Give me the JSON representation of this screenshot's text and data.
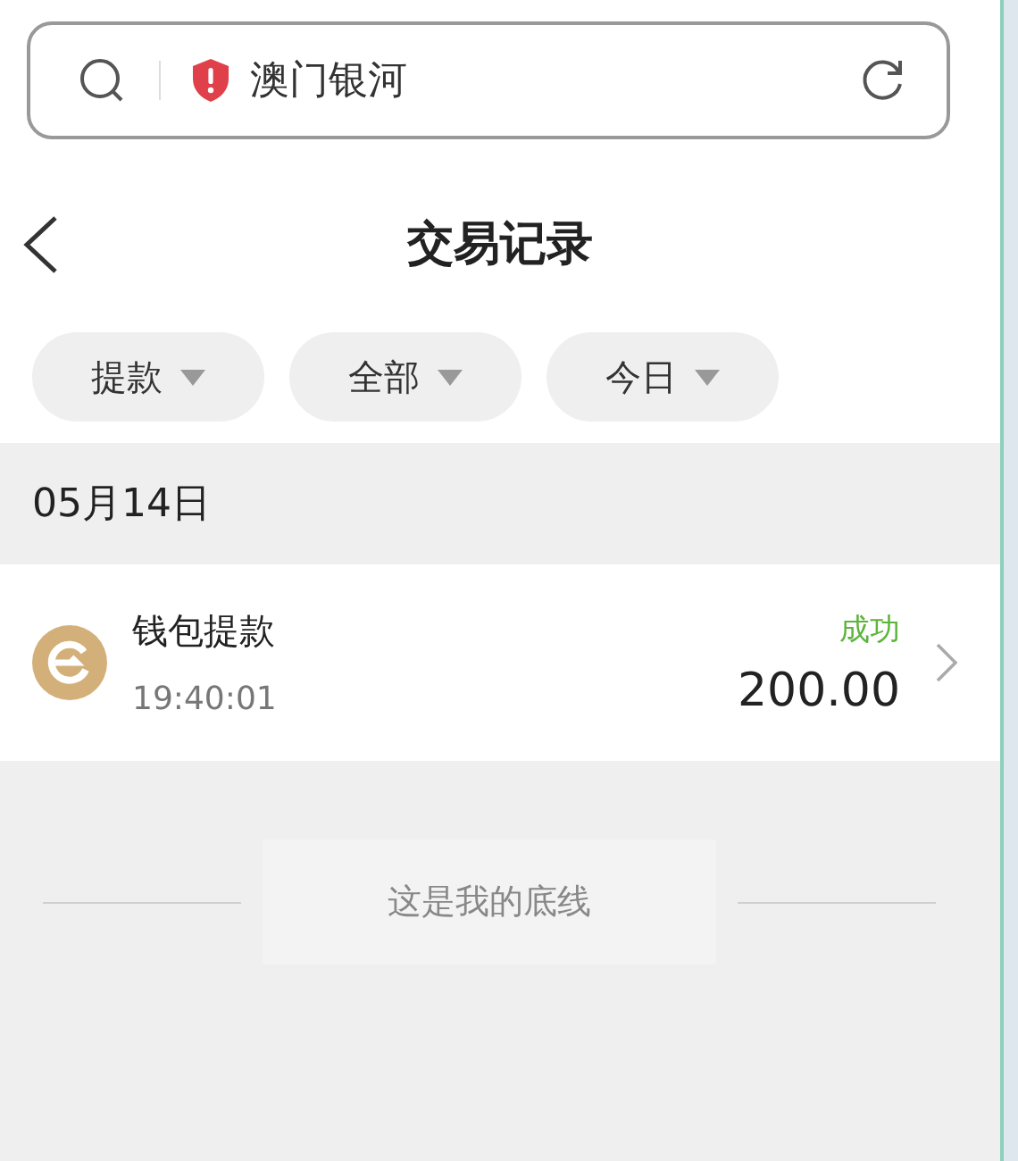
{
  "address_bar": {
    "site": "澳门银河"
  },
  "header": {
    "title": "交易记录"
  },
  "filters": [
    {
      "label": "提款"
    },
    {
      "label": "全部"
    },
    {
      "label": "今日"
    }
  ],
  "groups": [
    {
      "date": "05月14日",
      "transactions": [
        {
          "title": "钱包提款",
          "time": "19:40:01",
          "status": "成功",
          "amount": "200.00"
        }
      ]
    }
  ],
  "footer": {
    "text": "这是我的底线"
  }
}
